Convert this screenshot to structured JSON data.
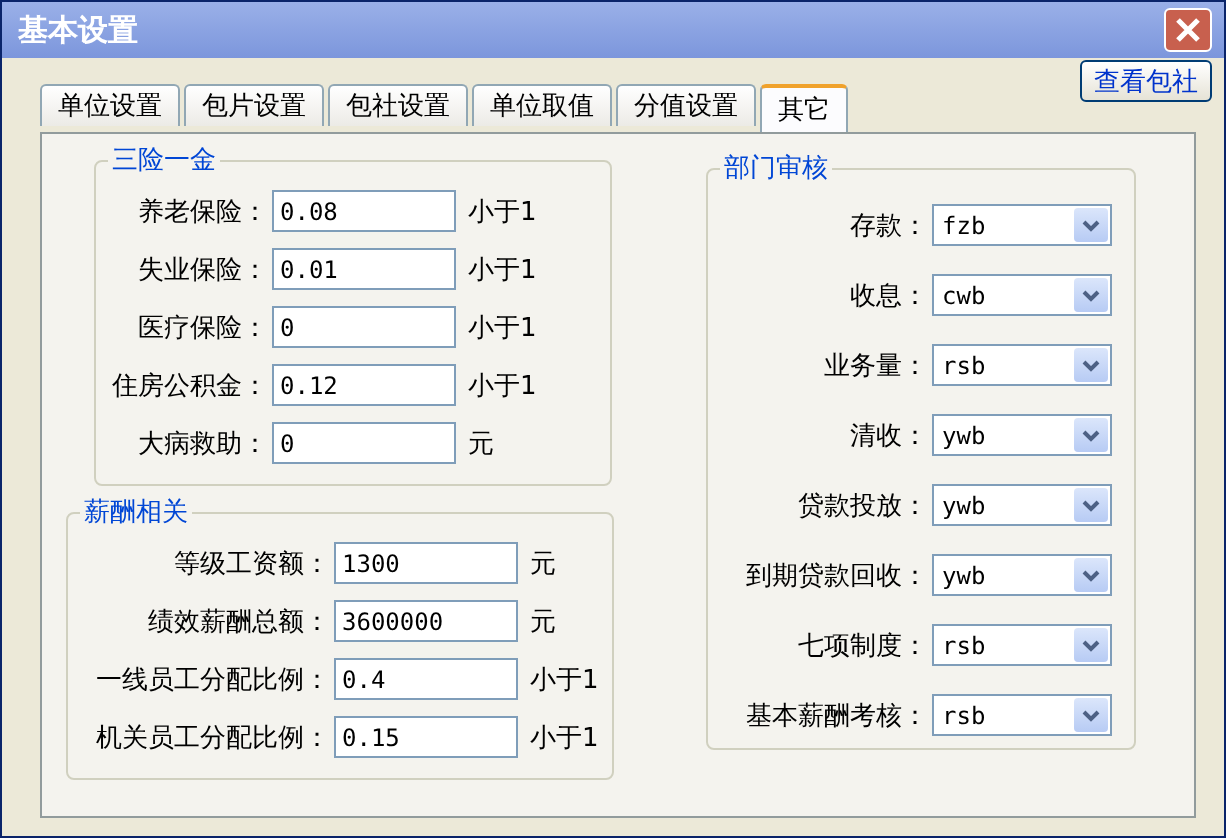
{
  "window": {
    "title": "基本设置"
  },
  "view_button": "查看包社",
  "tabs": [
    {
      "label": "单位设置",
      "selected": false
    },
    {
      "label": "包片设置",
      "selected": false
    },
    {
      "label": "包社设置",
      "selected": false
    },
    {
      "label": "单位取值",
      "selected": false
    },
    {
      "label": "分值设置",
      "selected": false
    },
    {
      "label": "其它",
      "selected": true
    }
  ],
  "insurance": {
    "title": "三险一金",
    "fields": [
      {
        "label": "养老保险：",
        "value": "0.08",
        "unit": "小于1"
      },
      {
        "label": "失业保险：",
        "value": "0.01",
        "unit": "小于1"
      },
      {
        "label": "医疗保险：",
        "value": "0",
        "unit": "小于1"
      },
      {
        "label": "住房公积金：",
        "value": "0.12",
        "unit": "小于1"
      },
      {
        "label": "大病救助：",
        "value": "0",
        "unit": "元"
      }
    ]
  },
  "salary": {
    "title": "薪酬相关",
    "fields": [
      {
        "label": "等级工资额：",
        "value": "1300",
        "unit": "元"
      },
      {
        "label": "绩效薪酬总额：",
        "value": "3600000",
        "unit": "元"
      },
      {
        "label": "一线员工分配比例：",
        "value": "0.4",
        "unit": "小于1"
      },
      {
        "label": "机关员工分配比例：",
        "value": "0.15",
        "unit": "小于1"
      }
    ]
  },
  "review": {
    "title": "部门审核",
    "fields": [
      {
        "label": "存款：",
        "value": "fzb"
      },
      {
        "label": "收息：",
        "value": "cwb"
      },
      {
        "label": "业务量：",
        "value": "rsb"
      },
      {
        "label": "清收：",
        "value": "ywb"
      },
      {
        "label": "贷款投放：",
        "value": "ywb"
      },
      {
        "label": "到期贷款回收：",
        "value": "ywb"
      },
      {
        "label": "七项制度：",
        "value": "rsb"
      },
      {
        "label": "基本薪酬考核：",
        "value": "rsb"
      }
    ]
  }
}
